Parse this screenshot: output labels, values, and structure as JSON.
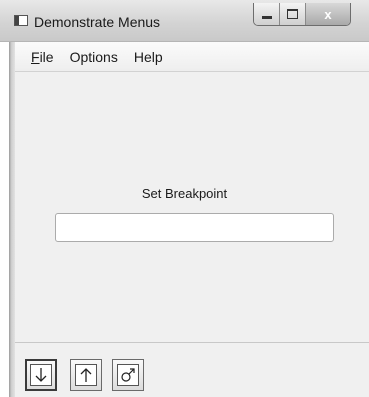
{
  "window": {
    "title": "Demonstrate Menus",
    "close_glyph": "x"
  },
  "menubar": {
    "items": [
      {
        "label": "File",
        "mnemonic": "F"
      },
      {
        "label": "Options"
      },
      {
        "label": "Help"
      }
    ]
  },
  "main": {
    "label": "Set Breakpoint",
    "input_value": ""
  },
  "toolbar": {
    "buttons": [
      {
        "icon": "step-into-icon",
        "selected": true
      },
      {
        "icon": "step-out-icon",
        "selected": false
      },
      {
        "icon": "toggle-breakpoint-icon",
        "selected": false
      }
    ]
  }
}
